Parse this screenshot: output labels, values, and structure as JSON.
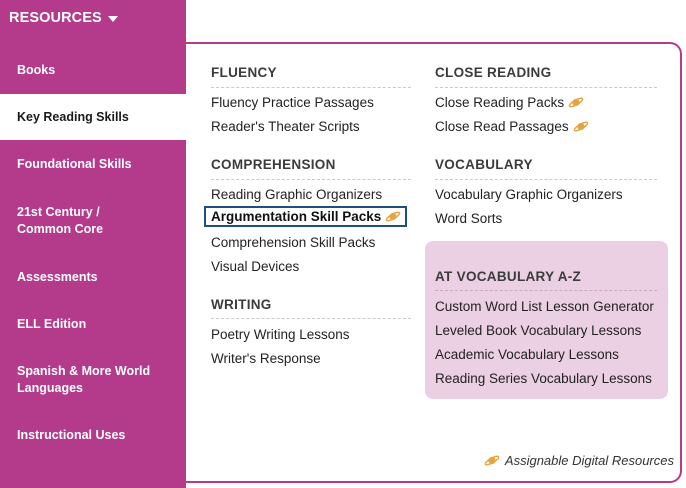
{
  "header": {
    "title": "RESOURCES",
    "caret_icon": "caret-down-icon"
  },
  "sidebar": {
    "items": [
      {
        "label": "Books"
      },
      {
        "label": "Key Reading Skills",
        "active": true
      },
      {
        "label": "Foundational Skills"
      },
      {
        "label": "21st Century / Common Core"
      },
      {
        "label": "Assessments"
      },
      {
        "label": "ELL Edition"
      },
      {
        "label": "Spanish & More World Languages"
      },
      {
        "label": "Instructional Uses"
      }
    ]
  },
  "sections": {
    "fluency": {
      "title": "FLUENCY",
      "links": [
        "Fluency Practice Passages",
        "Reader's Theater Scripts"
      ]
    },
    "comprehension": {
      "title": "COMPREHENSION",
      "links": [
        "Reading Graphic Organizers",
        "Argumentation Skill Packs",
        "Comprehension Skill Packs",
        "Visual Devices"
      ]
    },
    "writing": {
      "title": "WRITING",
      "links": [
        "Poetry Writing Lessons",
        "Writer's Response"
      ]
    },
    "close_reading": {
      "title": "CLOSE READING",
      "links": [
        "Close Reading Packs",
        "Close Read Passages"
      ]
    },
    "vocabulary": {
      "title": "VOCABULARY",
      "links": [
        "Vocabulary Graphic Organizers",
        "Word Sorts"
      ]
    },
    "vocab_az": {
      "title": "AT VOCABULARY A-Z",
      "links": [
        "Custom Word List Lesson Generator",
        "Leveled Book Vocabulary Lessons",
        "Academic Vocabulary Lessons",
        "Reading Series Vocabulary Lessons"
      ]
    }
  },
  "footer": {
    "note": "Assignable Digital Resources",
    "icon": "planet-icon"
  },
  "colors": {
    "brand": "#b43b8c",
    "active_bg": "#ffffff",
    "highlight_border": "#1f4f7a",
    "az_box_bg": "#ebcfe2",
    "planet": "#e8a33d"
  }
}
